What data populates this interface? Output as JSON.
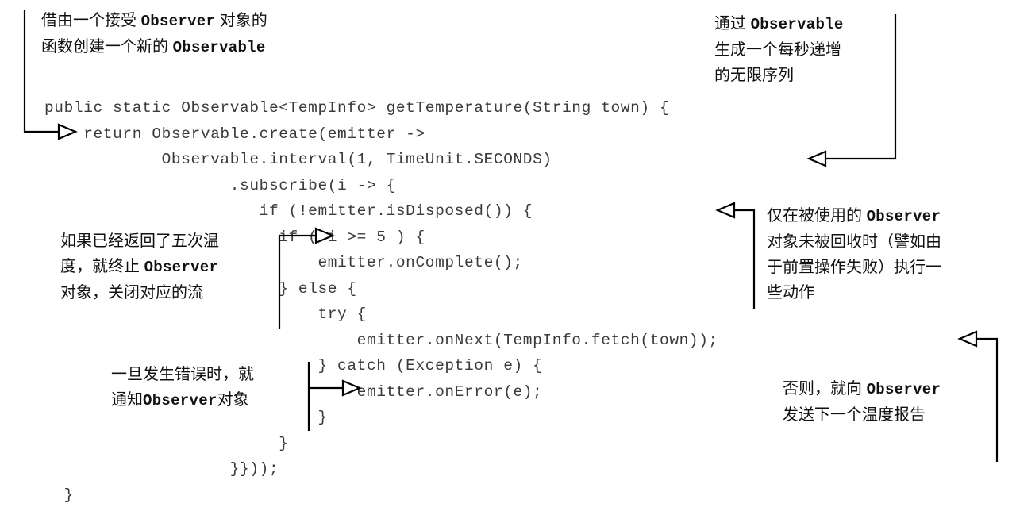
{
  "figure": {
    "kind": "annotated-code-listing",
    "language": "Java",
    "background_color": "#ffffff",
    "code_color": "#3a3a3a",
    "annotation_color": "#111111",
    "leader_color": "#000000"
  },
  "code": {
    "lines": [
      "public static Observable<TempInfo> getTemperature(String town) {",
      "    return Observable.create(emitter ->",
      "            Observable.interval(1, TimeUnit.SECONDS)",
      "                   .subscribe(i -> {",
      "                      if (!emitter.isDisposed()) {",
      "                        if ( i >= 5 ) {",
      "                            emitter.onComplete();",
      "                        } else {",
      "                            try {",
      "                                emitter.onNext(TempInfo.fetch(town));",
      "                            } catch (Exception e) {",
      "                                emitter.onError(e);",
      "                            }",
      "                        }",
      "                   }}));",
      "  }"
    ]
  },
  "annotations": [
    {
      "id": "note-create",
      "name": "annotation-create-observable",
      "text_line1_prefix": "借由一个接受 ",
      "text_line1_mono": "Observer",
      "text_line1_suffix": " 对象的",
      "text_line2_prefix": "函数创建一个新的 ",
      "text_line2_mono": "Observable",
      "text_line2_suffix": "",
      "points_to": "return Observable.create(emitter ->",
      "arrow_direction": "right"
    },
    {
      "id": "note-interval",
      "name": "annotation-interval-sequence",
      "text_line1_prefix": "通过 ",
      "text_line1_mono": "Observable",
      "text_line1_suffix": "",
      "text_line2_prefix": "生成一个每秒递增",
      "text_line2_mono": "",
      "text_line2_suffix": "",
      "text_line3_prefix": "的无限序列",
      "points_to": "Observable.interval(1, TimeUnit.SECONDS)",
      "arrow_direction": "left"
    },
    {
      "id": "note-five",
      "name": "annotation-five-temperatures",
      "text_line1_prefix": "如果已经返回了五次温",
      "text_line2_prefix": "度，就终止 ",
      "text_line2_mono": "Observer",
      "text_line3_prefix": "对象，关闭对应的流",
      "points_to": "if ( i >= 5 ) {",
      "arrow_direction": "right"
    },
    {
      "id": "note-disposed",
      "name": "annotation-not-disposed",
      "text_line1_prefix": "仅在被使用的 ",
      "text_line1_mono": "Observer",
      "text_line2_prefix": "对象未被回收时（譬如由",
      "text_line3_prefix": "于前置操作失败）执行一",
      "text_line4_prefix": "些动作",
      "points_to": "if (!emitter.isDisposed()) {",
      "arrow_direction": "left"
    },
    {
      "id": "note-error",
      "name": "annotation-on-error",
      "text_line1_prefix": "一旦发生错误时，就",
      "text_line2_prefix": "通知",
      "text_line2_mono": "Observer",
      "text_line2_suffix": "对象",
      "points_to": "emitter.onError(e);",
      "arrow_direction": "right"
    },
    {
      "id": "note-onnext",
      "name": "annotation-on-next",
      "text_line1_prefix": "否则，就向 ",
      "text_line1_mono": "Observer",
      "text_line2_prefix": "发送下一个温度报告",
      "points_to": "emitter.onNext(TempInfo.fetch(town));",
      "arrow_direction": "left"
    }
  ],
  "notes": {
    "create": {
      "l1a": "借由一个接受 ",
      "l1m": "Observer",
      "l1b": " 对象的",
      "l2a": "函数创建一个新的 ",
      "l2m": "Observable",
      "l2b": ""
    },
    "interval": {
      "l1a": "通过 ",
      "l1m": "Observable",
      "l1b": "",
      "l2": "生成一个每秒递增",
      "l3": "的无限序列"
    },
    "five": {
      "l1": "如果已经返回了五次温",
      "l2a": "度，就终止 ",
      "l2m": "Observer",
      "l2b": "",
      "l3": "对象，关闭对应的流"
    },
    "disposed": {
      "l1a": "仅在被使用的 ",
      "l1m": "Observer",
      "l1b": "",
      "l2": "对象未被回收时（譬如由",
      "l3": "于前置操作失败）执行一",
      "l4": "些动作"
    },
    "error": {
      "l1": "一旦发生错误时，就",
      "l2a": "通知",
      "l2m": "Observer",
      "l2b": "对象"
    },
    "onnext": {
      "l1a": "否则，就向 ",
      "l1m": "Observer",
      "l1b": "",
      "l2": "发送下一个温度报告"
    }
  }
}
